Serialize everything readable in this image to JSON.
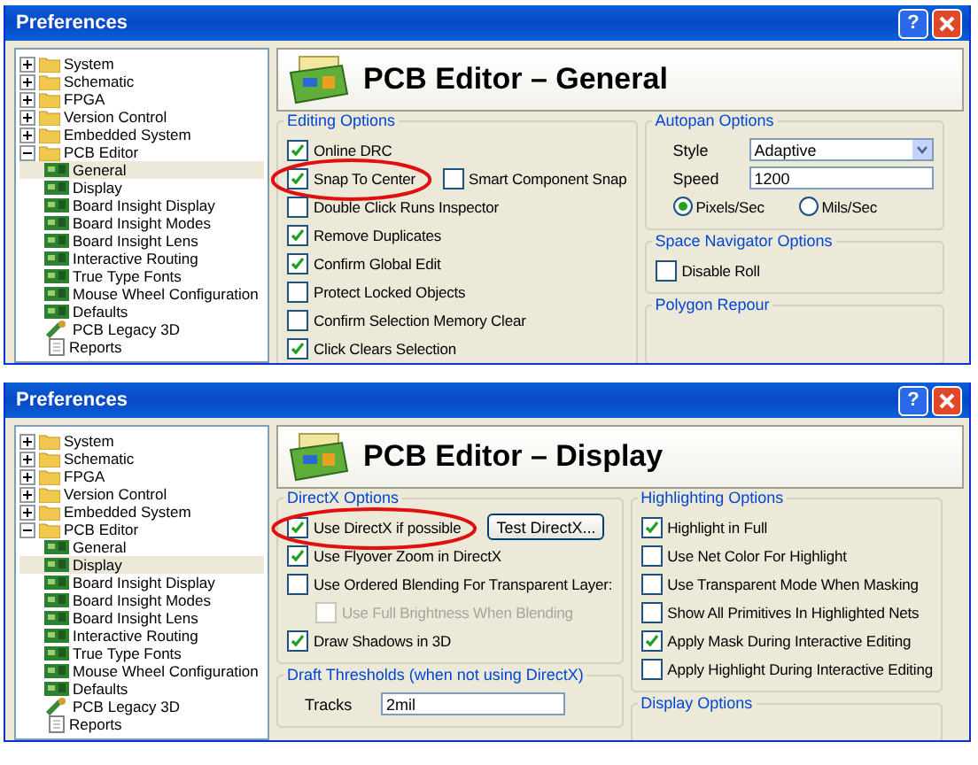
{
  "windows": [
    {
      "title": "Preferences",
      "help_button": "?",
      "header_title": "PCB Editor – General",
      "tree": [
        {
          "label": "System",
          "expanded": false
        },
        {
          "label": "Schematic",
          "expanded": false
        },
        {
          "label": "FPGA",
          "expanded": false
        },
        {
          "label": "Version Control",
          "expanded": false
        },
        {
          "label": "Embedded System",
          "expanded": false
        },
        {
          "label": "PCB Editor",
          "expanded": true,
          "children": [
            {
              "label": "General",
              "kind": "board",
              "selected": true
            },
            {
              "label": "Display",
              "kind": "board",
              "selected": false
            },
            {
              "label": "Board Insight Display",
              "kind": "board",
              "selected": false
            },
            {
              "label": "Board Insight Modes",
              "kind": "board",
              "selected": false
            },
            {
              "label": "Board Insight Lens",
              "kind": "board",
              "selected": false
            },
            {
              "label": "Interactive Routing",
              "kind": "board",
              "selected": false
            },
            {
              "label": "True Type Fonts",
              "kind": "board",
              "selected": false
            },
            {
              "label": "Mouse Wheel Configuration",
              "kind": "board",
              "selected": false
            },
            {
              "label": "Defaults",
              "kind": "board",
              "selected": false
            },
            {
              "label": "PCB Legacy 3D",
              "kind": "legacy",
              "selected": false
            },
            {
              "label": "Reports",
              "kind": "report",
              "selected": false
            }
          ]
        }
      ],
      "columns": [
        [
          {
            "title": "Editing Options",
            "items": [
              {
                "kind": "checkbox",
                "label": "Online DRC",
                "checked": true,
                "circled": false
              },
              {
                "kind": "checkbox",
                "label": "Snap To Center",
                "checked": true,
                "circled": true,
                "extra": {
                  "kind": "checkbox",
                  "label": "Smart Component Snap",
                  "checked": false
                }
              },
              {
                "kind": "checkbox",
                "label": "Double Click Runs Inspector",
                "checked": false,
                "circled": false
              },
              {
                "kind": "checkbox",
                "label": "Remove Duplicates",
                "checked": true,
                "circled": false
              },
              {
                "kind": "checkbox",
                "label": "Confirm Global Edit",
                "checked": true,
                "circled": false
              },
              {
                "kind": "checkbox",
                "label": "Protect Locked Objects",
                "checked": false,
                "circled": false
              },
              {
                "kind": "checkbox",
                "label": "Confirm Selection Memory Clear",
                "checked": false,
                "circled": false
              },
              {
                "kind": "checkbox",
                "label": "Click Clears Selection",
                "checked": true,
                "circled": false
              }
            ]
          }
        ],
        [
          {
            "title": "Autopan Options",
            "items": [
              {
                "kind": "select",
                "label": "Style",
                "value": "Adaptive"
              },
              {
                "kind": "input",
                "label": "Speed",
                "value": "1200"
              },
              {
                "kind": "radios",
                "options": [
                  {
                    "label": "Pixels/Sec",
                    "selected": true
                  },
                  {
                    "label": "Mils/Sec",
                    "selected": false
                  }
                ]
              }
            ]
          },
          {
            "title": "Space Navigator Options",
            "items": [
              {
                "kind": "checkbox",
                "label": "Disable Roll",
                "checked": false,
                "circled": false
              }
            ]
          },
          {
            "title": "Polygon Repour"
          }
        ]
      ]
    },
    {
      "title": "Preferences",
      "help_button": "?",
      "header_title": "PCB Editor – Display",
      "tree": [
        {
          "label": "System",
          "expanded": false
        },
        {
          "label": "Schematic",
          "expanded": false
        },
        {
          "label": "FPGA",
          "expanded": false
        },
        {
          "label": "Version Control",
          "expanded": false
        },
        {
          "label": "Embedded System",
          "expanded": false
        },
        {
          "label": "PCB Editor",
          "expanded": true,
          "children": [
            {
              "label": "General",
              "kind": "board",
              "selected": false
            },
            {
              "label": "Display",
              "kind": "board",
              "selected": true
            },
            {
              "label": "Board Insight Display",
              "kind": "board",
              "selected": false
            },
            {
              "label": "Board Insight Modes",
              "kind": "board",
              "selected": false
            },
            {
              "label": "Board Insight Lens",
              "kind": "board",
              "selected": false
            },
            {
              "label": "Interactive Routing",
              "kind": "board",
              "selected": false
            },
            {
              "label": "True Type Fonts",
              "kind": "board",
              "selected": false
            },
            {
              "label": "Mouse Wheel Configuration",
              "kind": "board",
              "selected": false
            },
            {
              "label": "Defaults",
              "kind": "board",
              "selected": false
            },
            {
              "label": "PCB Legacy 3D",
              "kind": "legacy",
              "selected": false
            },
            {
              "label": "Reports",
              "kind": "report",
              "selected": false
            }
          ]
        }
      ],
      "columns": [
        [
          {
            "title": "DirectX Options",
            "items": [
              {
                "kind": "checkbox",
                "label": "Use DirectX if possible",
                "checked": true,
                "circled": true,
                "extra": {
                  "kind": "button",
                  "label": "Test DirectX..."
                }
              },
              {
                "kind": "checkbox",
                "label": "Use Flyover Zoom in DirectX",
                "checked": true,
                "circled": false
              },
              {
                "kind": "checkbox",
                "label": "Use Ordered Blending For Transparent Layer:",
                "checked": false,
                "circled": false
              },
              {
                "kind": "checkbox",
                "label": "Use Full Brightness When Blending",
                "checked": false,
                "circled": false,
                "disabled": true
              },
              {
                "kind": "checkbox",
                "label": "Draw Shadows in 3D",
                "checked": true,
                "circled": false
              }
            ]
          },
          {
            "title": "Draft Thresholds (when not using DirectX)",
            "items": [
              {
                "kind": "input",
                "label": "Tracks",
                "value": "2mil"
              }
            ]
          }
        ],
        [
          {
            "title": "Highlighting Options",
            "items": [
              {
                "kind": "checkbox",
                "label": "Highlight in Full",
                "checked": true,
                "circled": false
              },
              {
                "kind": "checkbox",
                "label": "Use Net Color For Highlight",
                "checked": false,
                "circled": false
              },
              {
                "kind": "checkbox",
                "label": "Use Transparent Mode When Masking",
                "checked": false,
                "circled": false
              },
              {
                "kind": "checkbox",
                "label": "Show All Primitives In Highlighted Nets",
                "checked": false,
                "circled": false
              },
              {
                "kind": "checkbox",
                "label": "Apply Mask During Interactive Editing",
                "checked": true,
                "circled": false
              },
              {
                "kind": "checkbox",
                "label": "Apply Highlight During Interactive Editing",
                "checked": false,
                "circled": false
              }
            ]
          },
          {
            "title": "Display Options"
          }
        ]
      ]
    }
  ]
}
